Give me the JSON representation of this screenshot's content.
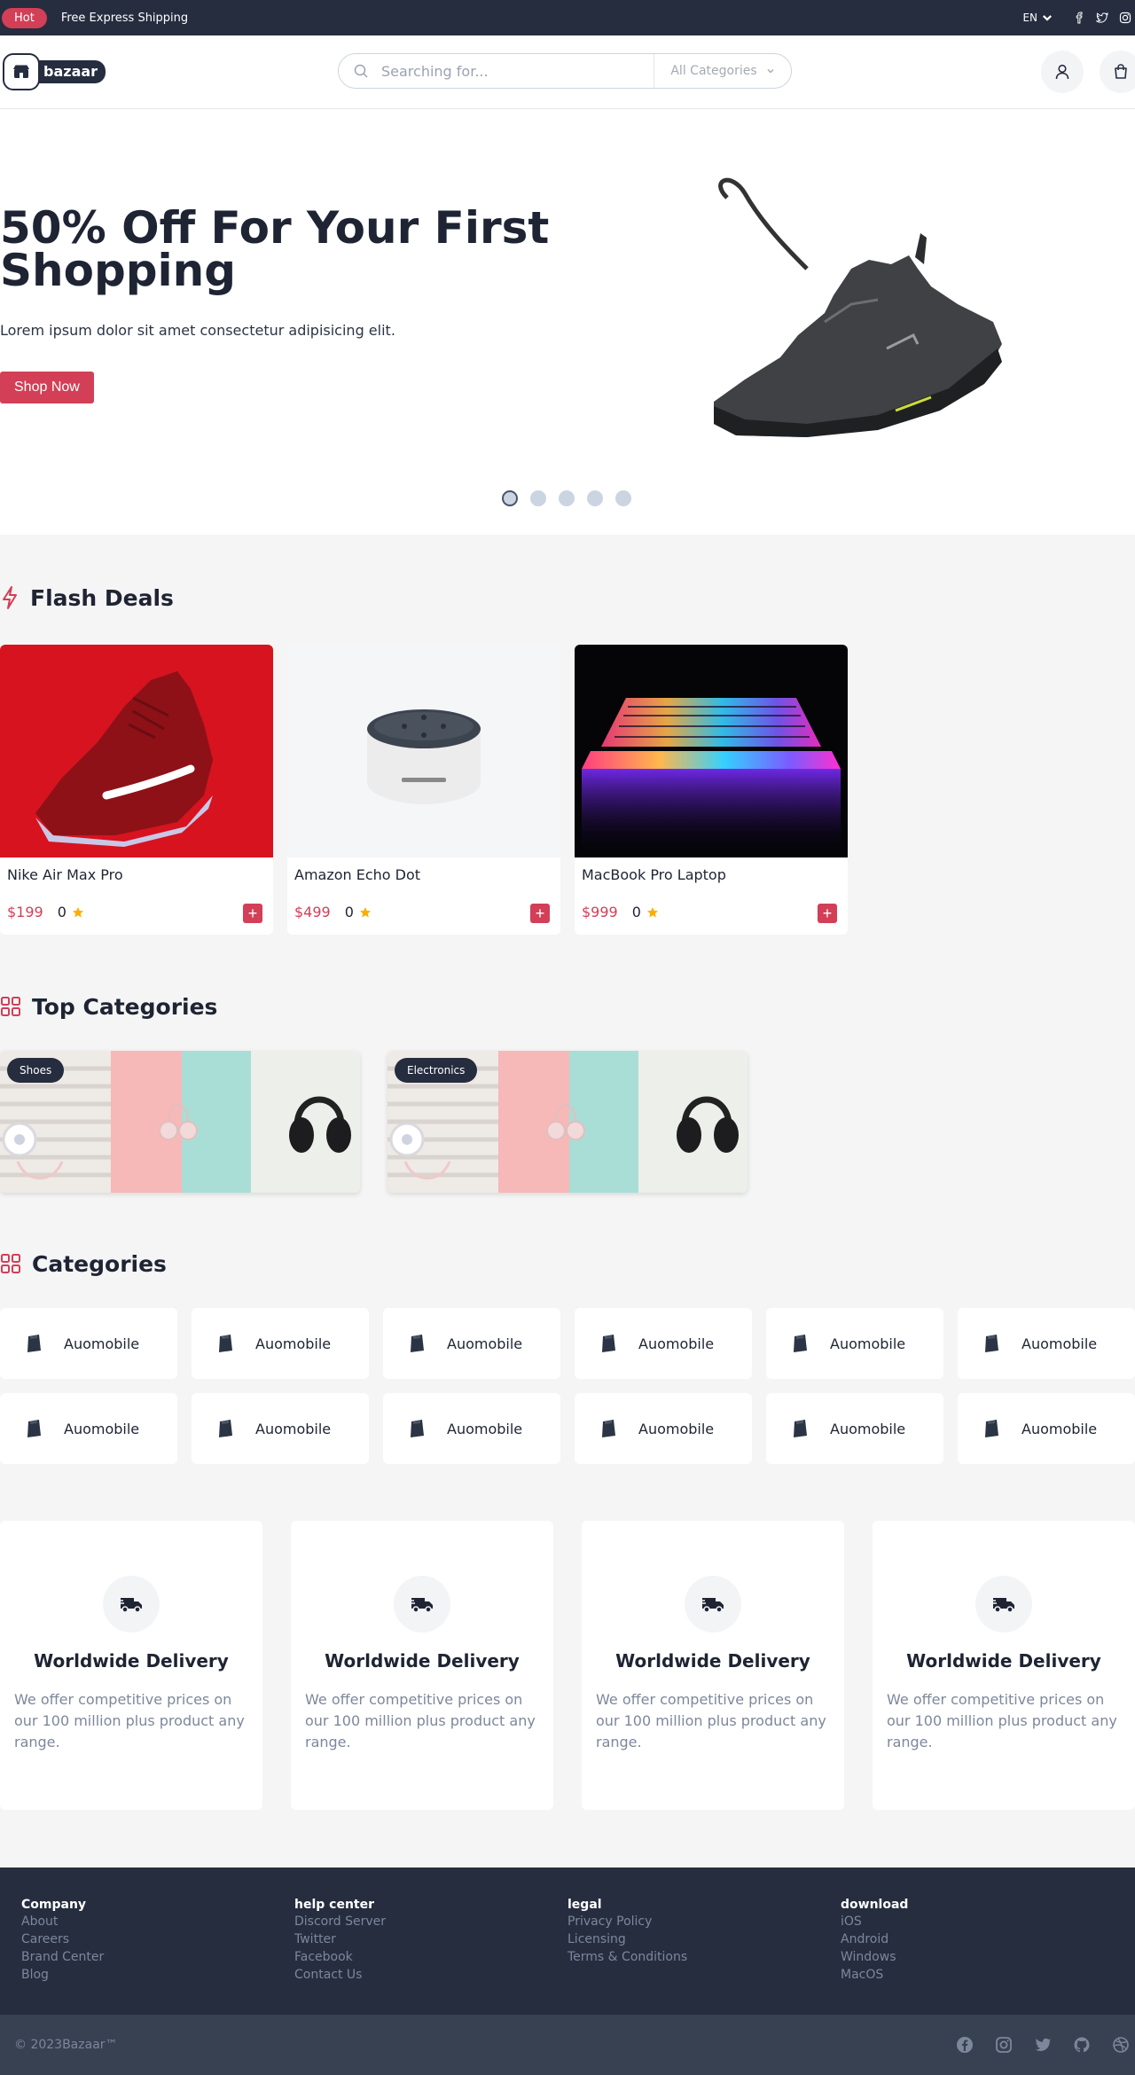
{
  "topbar": {
    "badge": "Hot",
    "shipping_text": "Free Express Shipping",
    "language": "EN",
    "social_icons": [
      "facebook-icon",
      "twitter-icon",
      "instagram-icon"
    ]
  },
  "header": {
    "logo_text": "bazaar",
    "search_placeholder": "Searching for...",
    "category_select": "All Categories",
    "icons": [
      "user-icon",
      "cart-icon"
    ]
  },
  "hero": {
    "title": "50% Off For Your First Shopping",
    "subtitle": "Lorem ipsum dolor sit amet consectetur adipisicing elit.",
    "button": "Shop Now",
    "slide_count": 5,
    "active_slide": 1
  },
  "flash_deals": {
    "title": "Flash Deals",
    "products": [
      {
        "name": "Nike Air Max Pro",
        "price": "$199",
        "rating": "0"
      },
      {
        "name": "Amazon Echo Dot",
        "price": "$499",
        "rating": "0"
      },
      {
        "name": "MacBook Pro Laptop",
        "price": "$999",
        "rating": "0"
      }
    ]
  },
  "top_categories": {
    "title": "Top Categories",
    "items": [
      {
        "label": "Shoes"
      },
      {
        "label": "Electronics"
      }
    ]
  },
  "categories": {
    "title": "Categories",
    "items": [
      {
        "label": "Auomobile"
      },
      {
        "label": "Auomobile"
      },
      {
        "label": "Auomobile"
      },
      {
        "label": "Auomobile"
      },
      {
        "label": "Auomobile"
      },
      {
        "label": "Auomobile"
      },
      {
        "label": "Auomobile"
      },
      {
        "label": "Auomobile"
      },
      {
        "label": "Auomobile"
      },
      {
        "label": "Auomobile"
      },
      {
        "label": "Auomobile"
      },
      {
        "label": "Auomobile"
      }
    ]
  },
  "services": [
    {
      "title": "Worldwide Delivery",
      "desc": "We offer competitive prices on our 100 million plus product any range."
    },
    {
      "title": "Worldwide Delivery",
      "desc": "We offer competitive prices on our 100 million plus product any range."
    },
    {
      "title": "Worldwide Delivery",
      "desc": "We offer competitive prices on our 100 million plus product any range."
    },
    {
      "title": "Worldwide Delivery",
      "desc": "We offer competitive prices on our 100 million plus product any range."
    }
  ],
  "footer": {
    "columns": [
      {
        "heading": "Company",
        "links": [
          "About",
          "Careers",
          "Brand Center",
          "Blog"
        ]
      },
      {
        "heading": "help center",
        "links": [
          "Discord Server",
          "Twitter",
          "Facebook",
          "Contact Us"
        ]
      },
      {
        "heading": "legal",
        "links": [
          "Privacy Policy",
          "Licensing",
          "Terms & Conditions"
        ]
      },
      {
        "heading": "download",
        "links": [
          "iOS",
          "Android",
          "Windows",
          "MacOS"
        ]
      }
    ],
    "copyright": "© 2023Bazaar™",
    "social_icons": [
      "facebook-icon",
      "instagram-icon",
      "twitter-icon",
      "github-icon",
      "dribbble-icon"
    ]
  },
  "colors": {
    "accent": "#d23f57",
    "dark": "#252d3f",
    "muted": "#7d879c"
  }
}
